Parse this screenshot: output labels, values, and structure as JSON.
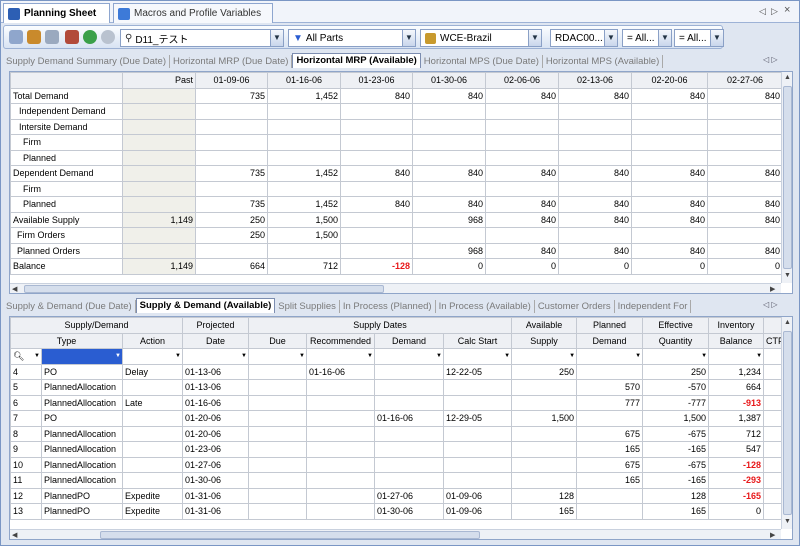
{
  "window": {
    "tabs": [
      {
        "label": "Planning Sheet",
        "icon": "planning-sheet-icon",
        "color": "#2d5fb4"
      },
      {
        "label": "Macros and Profile Variables",
        "icon": "macros-icon",
        "color": "#3d7ad8"
      }
    ],
    "controls": [
      "◁",
      "▷",
      "×"
    ]
  },
  "toolbar": {
    "filter_name": "D11_テスト",
    "parts": "All Parts",
    "site": "WCE-Brazil",
    "rda": "RDAC00...",
    "all1": "= All...",
    "all2": "= All..."
  },
  "top_tabs": [
    "Supply Demand Summary (Due Date)",
    "Horizontal MRP (Due Date)",
    "Horizontal MRP (Available)",
    "Horizontal MPS (Due Date)",
    "Horizontal MPS (Available)"
  ],
  "mrp": {
    "columns": [
      "",
      "Past",
      "01-09-06",
      "01-16-06",
      "01-23-06",
      "01-30-06",
      "02-06-06",
      "02-13-06",
      "02-20-06",
      "02-27-06"
    ],
    "rows": [
      {
        "label": "Total Demand",
        "cells": [
          "",
          "735",
          "1,452",
          "840",
          "840",
          "840",
          "840",
          "840",
          "840"
        ]
      },
      {
        "label": "Independent Demand",
        "cells": [
          "",
          "",
          "",
          "",
          "",
          "",
          "",
          "",
          ""
        ]
      },
      {
        "label": "Intersite Demand",
        "cells": [
          "",
          "",
          "",
          "",
          "",
          "",
          "",
          "",
          ""
        ]
      },
      {
        "label": "Firm",
        "cells": [
          "",
          "",
          "",
          "",
          "",
          "",
          "",
          "",
          ""
        ]
      },
      {
        "label": "Planned",
        "cells": [
          "",
          "",
          "",
          "",
          "",
          "",
          "",
          "",
          ""
        ]
      },
      {
        "label": "Dependent Demand",
        "cells": [
          "",
          "735",
          "1,452",
          "840",
          "840",
          "840",
          "840",
          "840",
          "840"
        ]
      },
      {
        "label": "Firm",
        "cells": [
          "",
          "",
          "",
          "",
          "",
          "",
          "",
          "",
          ""
        ]
      },
      {
        "label": "Planned",
        "cells": [
          "",
          "735",
          "1,452",
          "840",
          "840",
          "840",
          "840",
          "840",
          "840"
        ]
      },
      {
        "label": "Available Supply",
        "cells": [
          "1,149",
          "250",
          "1,500",
          "",
          "968",
          "840",
          "840",
          "840",
          "840"
        ]
      },
      {
        "label": "Firm Orders",
        "cells": [
          "",
          "250",
          "1,500",
          "",
          "",
          "",
          "",
          "",
          ""
        ]
      },
      {
        "label": "Planned Orders",
        "cells": [
          "",
          "",
          "",
          "",
          "968",
          "840",
          "840",
          "840",
          "840"
        ]
      },
      {
        "label": "Balance",
        "cells": [
          "1,149",
          "664",
          "712",
          "-128",
          "0",
          "0",
          "0",
          "0",
          "0"
        ]
      }
    ]
  },
  "bottom_tabs": [
    "Supply & Demand (Due Date)",
    "Supply & Demand (Available)",
    "Split Supplies",
    "In Process (Planned)",
    "In Process (Available)",
    "Customer Orders",
    "Independent For"
  ],
  "sd": {
    "group_headers": [
      "Supply/Demand",
      "Projected",
      "Supply Dates",
      "Available",
      "Planned",
      "Effective",
      "Inventory"
    ],
    "sub_headers": [
      "Type",
      "Action",
      "Date",
      "Due",
      "Recommended",
      "Demand",
      "Calc Start",
      "Supply",
      "Demand",
      "Quantity",
      "Balance",
      "CTP"
    ],
    "rows": [
      {
        "n": "4",
        "type": "PO",
        "action": "Delay",
        "date": "01-13-06",
        "due": "",
        "rec": "01-16-06",
        "dem": "",
        "calc": "12-22-05",
        "supply": "250",
        "pdem": "",
        "qty": "250",
        "bal": "1,234"
      },
      {
        "n": "5",
        "type": "PlannedAllocation",
        "action": "",
        "date": "01-13-06",
        "due": "",
        "rec": "",
        "dem": "",
        "calc": "",
        "supply": "",
        "pdem": "570",
        "qty": "-570",
        "bal": "664"
      },
      {
        "n": "6",
        "type": "PlannedAllocation",
        "action": "Late",
        "date": "01-16-06",
        "due": "",
        "rec": "",
        "dem": "",
        "calc": "",
        "supply": "",
        "pdem": "777",
        "qty": "-777",
        "bal": "-913"
      },
      {
        "n": "7",
        "type": "PO",
        "action": "",
        "date": "01-20-06",
        "due": "",
        "rec": "",
        "dem": "01-16-06",
        "calc": "12-29-05",
        "supply": "1,500",
        "pdem": "",
        "qty": "1,500",
        "bal": "1,387"
      },
      {
        "n": "8",
        "type": "PlannedAllocation",
        "action": "",
        "date": "01-20-06",
        "due": "",
        "rec": "",
        "dem": "",
        "calc": "",
        "supply": "",
        "pdem": "675",
        "qty": "-675",
        "bal": "712"
      },
      {
        "n": "9",
        "type": "PlannedAllocation",
        "action": "",
        "date": "01-23-06",
        "due": "",
        "rec": "",
        "dem": "",
        "calc": "",
        "supply": "",
        "pdem": "165",
        "qty": "-165",
        "bal": "547"
      },
      {
        "n": "10",
        "type": "PlannedAllocation",
        "action": "",
        "date": "01-27-06",
        "due": "",
        "rec": "",
        "dem": "",
        "calc": "",
        "supply": "",
        "pdem": "675",
        "qty": "-675",
        "bal": "-128"
      },
      {
        "n": "11",
        "type": "PlannedAllocation",
        "action": "",
        "date": "01-30-06",
        "due": "",
        "rec": "",
        "dem": "",
        "calc": "",
        "supply": "",
        "pdem": "165",
        "qty": "-165",
        "bal": "-293"
      },
      {
        "n": "12",
        "type": "PlannedPO",
        "action": "Expedite",
        "date": "01-31-06",
        "due": "",
        "rec": "",
        "dem": "01-27-06",
        "calc": "01-09-06",
        "supply": "128",
        "pdem": "",
        "qty": "128",
        "bal": "-165"
      },
      {
        "n": "13",
        "type": "PlannedPO",
        "action": "Expedite",
        "date": "01-31-06",
        "due": "",
        "rec": "",
        "dem": "01-30-06",
        "calc": "01-09-06",
        "supply": "165",
        "pdem": "",
        "qty": "165",
        "bal": "0"
      }
    ]
  },
  "colors": {
    "negative": "#e8181a",
    "accent": "#2a5dd1"
  }
}
